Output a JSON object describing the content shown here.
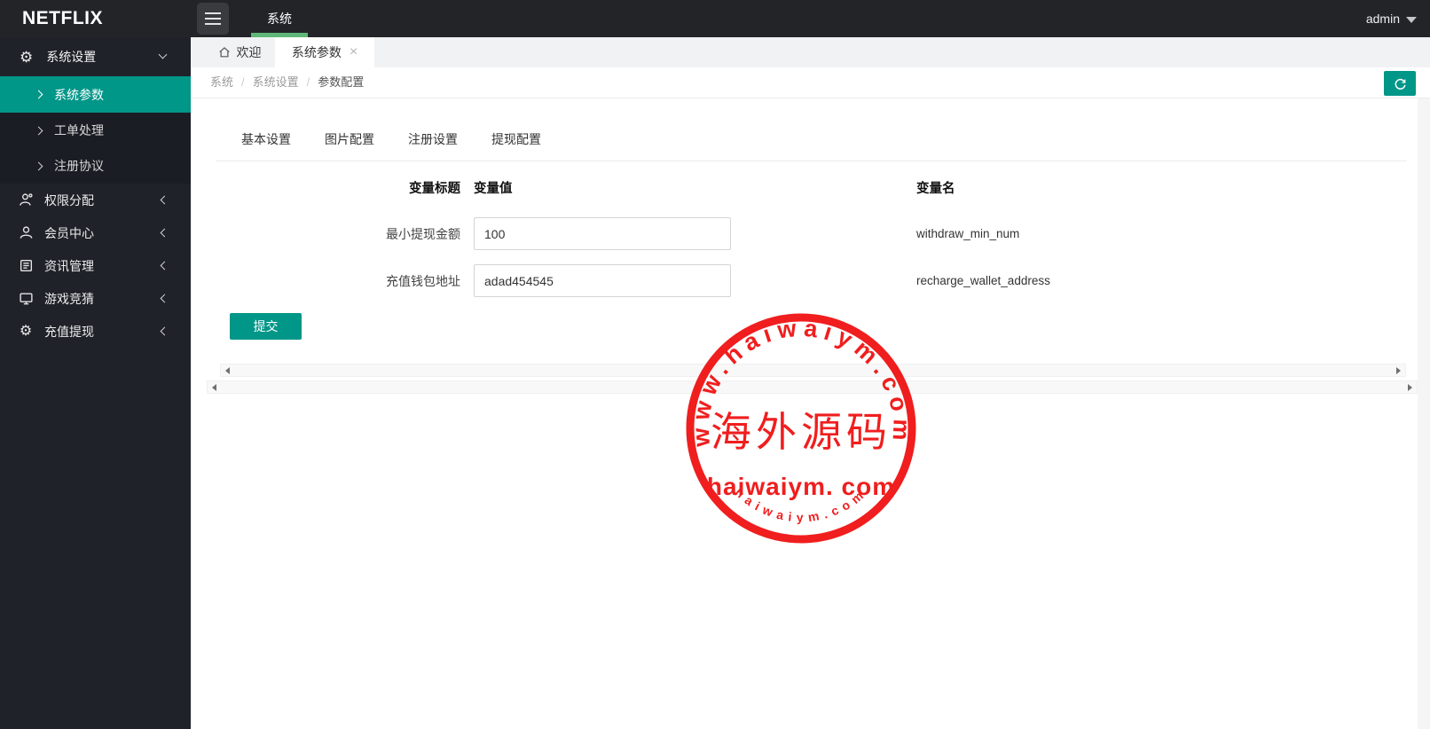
{
  "brand": {
    "logo": "NETFLIX"
  },
  "header": {
    "nav_item": "系统",
    "user": "admin"
  },
  "icons": {
    "gear": "⚙",
    "close": "×"
  },
  "sidebar": {
    "parent": {
      "label": "系统设置"
    },
    "submenu": [
      {
        "label": "系统参数",
        "active": true
      },
      {
        "label": "工单处理",
        "active": false
      },
      {
        "label": "注册协议",
        "active": false
      }
    ],
    "items": [
      {
        "label": "权限分配",
        "icon": "user-plus-icon"
      },
      {
        "label": "会员中心",
        "icon": "user-icon"
      },
      {
        "label": "资讯管理",
        "icon": "news-icon"
      },
      {
        "label": "游戏竞猜",
        "icon": "monitor-icon"
      },
      {
        "label": "充值提现",
        "icon": "gear-icon"
      }
    ]
  },
  "tabbar": {
    "home_tab": "欢迎",
    "active_tab": "系统参数"
  },
  "breadcrumb": {
    "items": [
      "系统",
      "系统设置",
      "参数配置"
    ],
    "separator": "/"
  },
  "content": {
    "filter_tabs": [
      "基本设置",
      "图片配置",
      "注册设置",
      "提现配置"
    ],
    "table": {
      "headers": {
        "title": "变量标题",
        "value": "变量值",
        "name": "变量名"
      },
      "rows": [
        {
          "title": "最小提现金额",
          "value": "100",
          "name": "withdraw_min_num"
        },
        {
          "title": "充值钱包地址",
          "value": "adad454545",
          "name": "recharge_wallet_address"
        }
      ]
    },
    "submit_label": "提交"
  },
  "watermark": {
    "arc_top": "www.haiwaiym.com",
    "center_cn": "海外源码",
    "center_en": "haiwaiym. com",
    "arc_bottom": "haiwaiym.com"
  },
  "colors": {
    "teal": "#009688",
    "green": "#5FB878",
    "sidebar_bg": "#20222A",
    "header_bg": "#232428",
    "stamp_red": "#f01212"
  }
}
